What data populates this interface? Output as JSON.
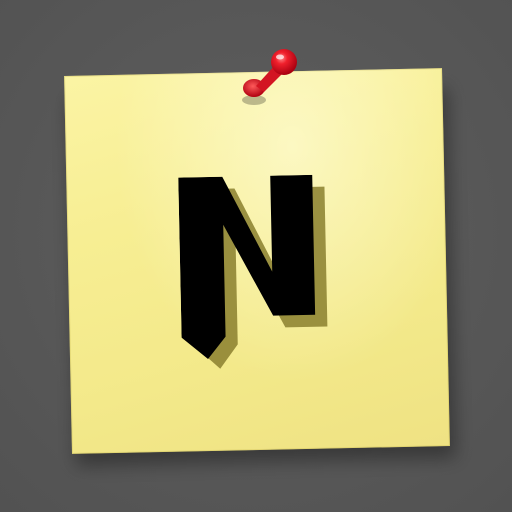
{
  "icon": {
    "name": "sticky-note-app-icon",
    "letter": "N",
    "colors": {
      "background": "#575757",
      "note": "#f7ee93",
      "letter": "#000000",
      "letter_shadow": "#8a7f2e",
      "pin": "#e0101e"
    }
  }
}
